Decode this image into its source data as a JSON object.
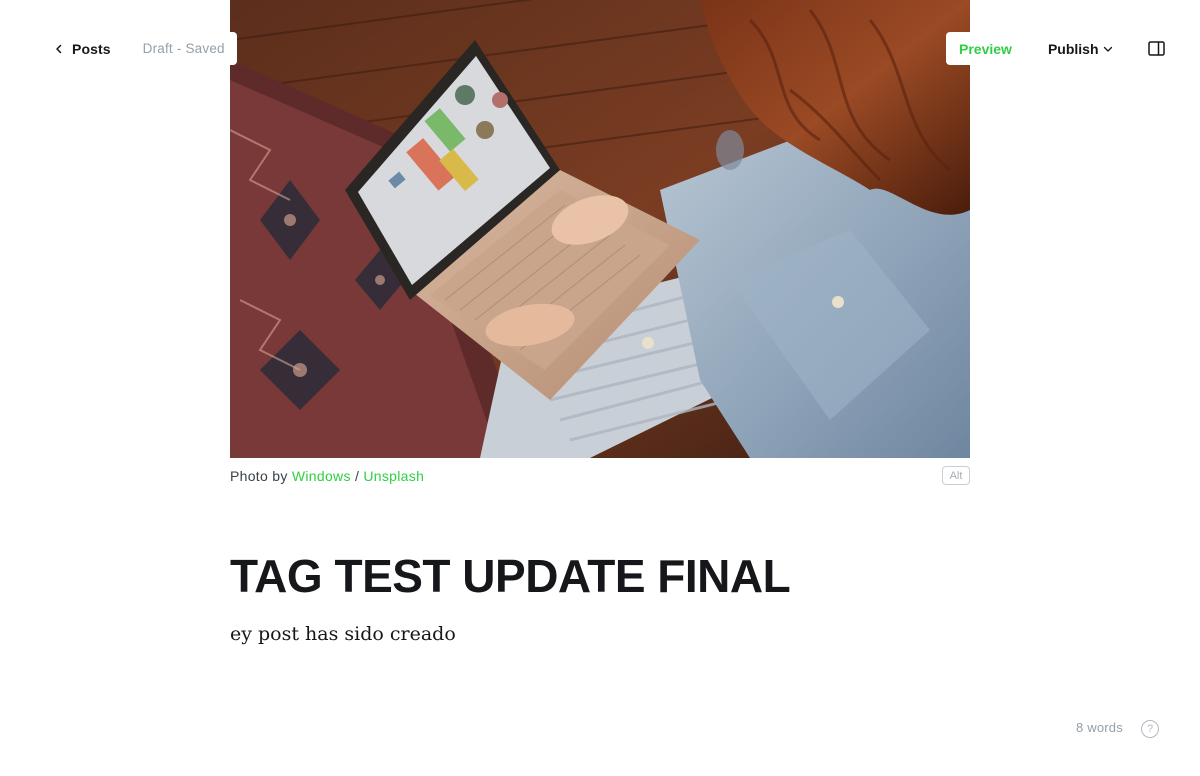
{
  "topbar": {
    "back_label": "Posts",
    "status": "Draft - Saved",
    "preview_label": "Preview",
    "publish_label": "Publish"
  },
  "feature_image": {
    "caption_prefix": "Photo by",
    "author": "Windows",
    "separator": "/",
    "source": "Unsplash",
    "alt_label": "Alt"
  },
  "post": {
    "title": "TAG TEST UPDATE FINAL",
    "body": "ey post has sido creado"
  },
  "footer": {
    "word_count": "8 words",
    "help_label": "?"
  },
  "colors": {
    "accent": "#30cf43",
    "text": "#15171a",
    "muted": "#95a0a8"
  }
}
